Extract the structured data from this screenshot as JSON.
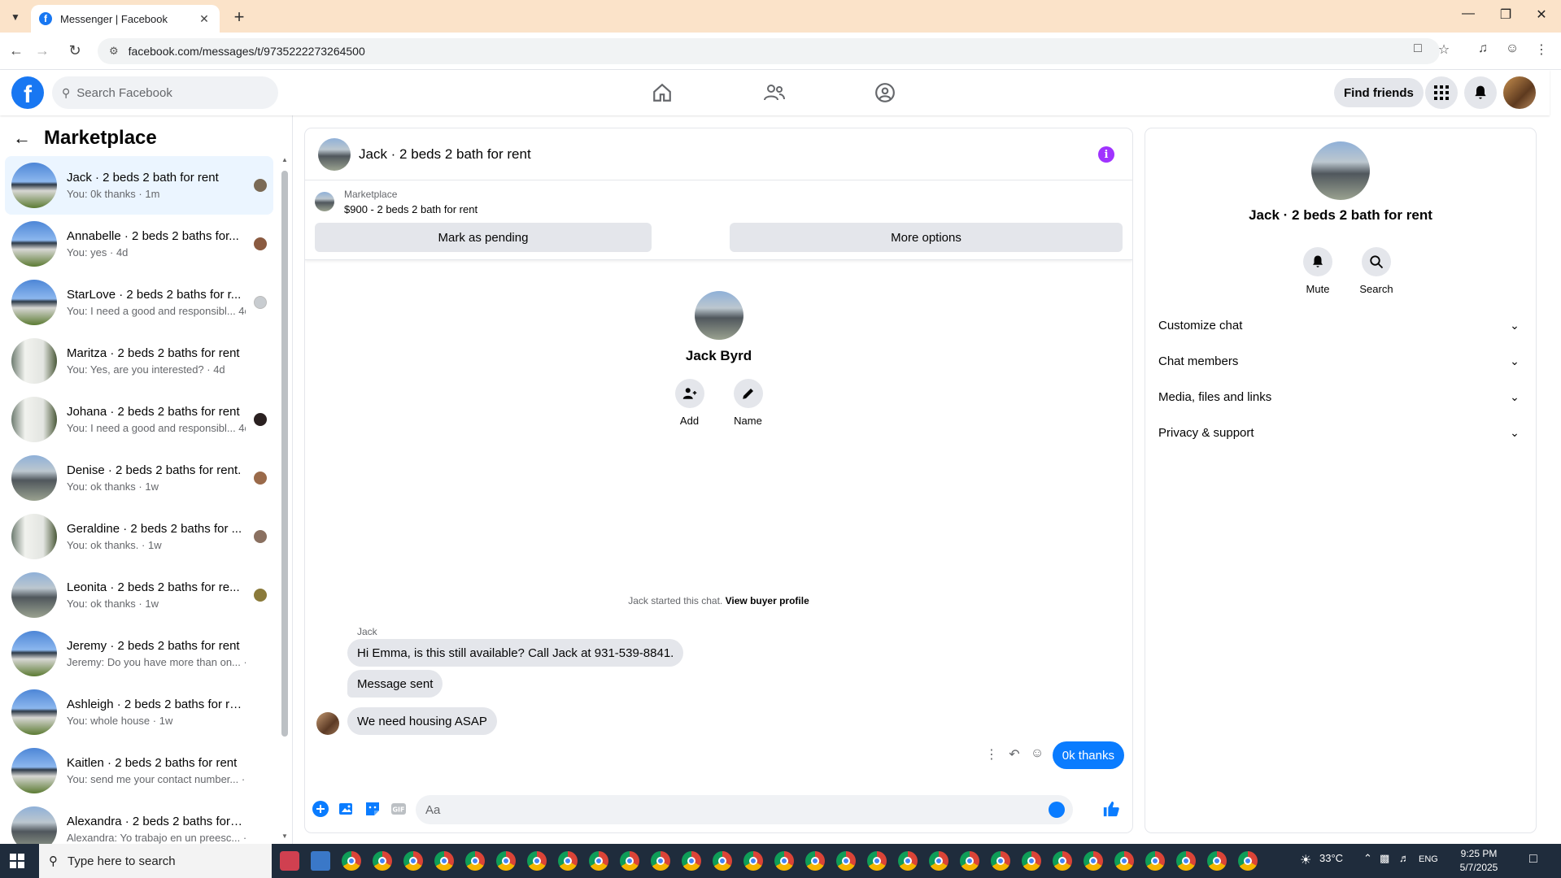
{
  "browser": {
    "tab_title": "Messenger | Facebook",
    "url": "facebook.com/messages/t/9735222273264500"
  },
  "header": {
    "search_placeholder": "Search Facebook",
    "find_friends": "Find friends"
  },
  "sidebar": {
    "title": "Marketplace",
    "conversations": [
      {
        "name": "Jack · 2 beds 2 bath for rent",
        "preview": "You: 0k thanks · 1m",
        "thumb": "sky"
      },
      {
        "name": "Annabelle · 2 beds 2 baths for...",
        "preview": "You: yes · 4d",
        "thumb": "sky"
      },
      {
        "name": "StarLove · 2 beds 2 baths for r...",
        "preview": "You: I need a good and responsibl... 4d",
        "thumb": "sky"
      },
      {
        "name": "Maritza · 2 beds 2 baths for rent",
        "preview": "You: Yes, are you interested? · 4d",
        "thumb": "white"
      },
      {
        "name": "Johana · 2 beds 2 baths for rent",
        "preview": "You: I need a good and responsibl... 4d",
        "thumb": "white"
      },
      {
        "name": "Denise · 2 beds 2 baths for rent.",
        "preview": "You: ok thanks · 1w",
        "thumb": "grey"
      },
      {
        "name": "Geraldine · 2 beds 2 baths for ...",
        "preview": "You: ok thanks. · 1w",
        "thumb": "white"
      },
      {
        "name": "Leonita · 2 beds 2 baths for re...",
        "preview": "You: ok thanks · 1w",
        "thumb": "grey"
      },
      {
        "name": "Jeremy · 2 beds 2 baths for rent",
        "preview": "Jeremy: Do you have more than on... · 1w",
        "thumb": "sky"
      },
      {
        "name": "Ashleigh · 2 beds 2 baths for rent",
        "preview": "You: whole house · 1w",
        "thumb": "sky"
      },
      {
        "name": "Kaitlen · 2 beds 2 baths for rent",
        "preview": "You: send me your contact number... · 1w",
        "thumb": "sky"
      },
      {
        "name": "Alexandra · 2 beds 2 baths for re...",
        "preview": "Alexandra: Yo trabajo en un preesc... · 1w",
        "thumb": "grey"
      }
    ]
  },
  "chat": {
    "title": "Jack · 2 beds 2 bath for rent",
    "marketplace_label": "Marketplace",
    "listing": "$900 - 2 beds 2 bath for rent",
    "mark_pending": "Mark as pending",
    "more_options": "More options",
    "profile_name": "Jack Byrd",
    "add_label": "Add",
    "name_label": "Name",
    "started_text": "Jack started this chat.",
    "view_buyer": "View buyer profile",
    "sender": "Jack",
    "messages": [
      "Hi Emma, is this still available? Call Jack at 931-539-8841.",
      "Message sent",
      "We need housing ASAP"
    ],
    "outgoing": "0k thanks",
    "composer_placeholder": "Aa"
  },
  "right_panel": {
    "name": "Jack · 2 beds 2 bath for rent",
    "mute": "Mute",
    "search": "Search",
    "sections": [
      "Customize chat",
      "Chat members",
      "Media, files and links",
      "Privacy & support"
    ]
  },
  "taskbar": {
    "search_text": "Type here to search",
    "temperature": "33°C",
    "language": "ENG",
    "time": "9:25 PM",
    "date": "5/7/2025"
  },
  "colors": {
    "fb_blue": "#1877f2",
    "messenger_blue": "#0a7cff",
    "info_purple": "#a033ff"
  }
}
